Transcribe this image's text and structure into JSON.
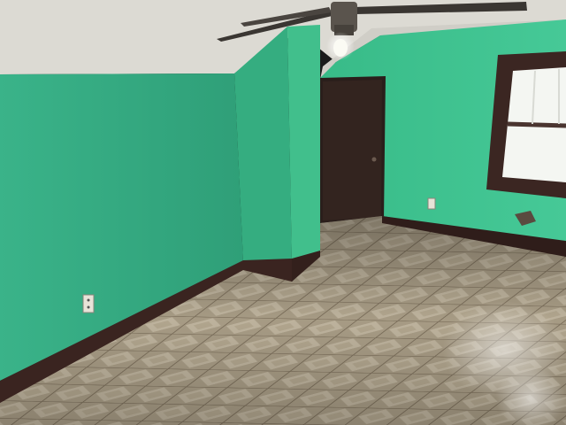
{
  "scene": {
    "subject": "",
    "elements": {
      "ceiling": "textured-ceiling",
      "fan": "ceiling-fan",
      "light": "bare-bulb",
      "left_wall": "green-wall",
      "column": "drywall-chase",
      "door": "dark-wood-door",
      "window": "double-hung-window",
      "floor": "vinyl-tile-floor",
      "outlet": "wall-outlet"
    }
  },
  "colors": {
    "wall_left": "#3fb58f",
    "wall_left_dark": "#2f9a76",
    "wall_right": "#3ec592",
    "wall_right_light": "#5ad4a3",
    "column_front": "#3fbd8a",
    "column_side": "#37a97e",
    "ceiling": "#e3e1da",
    "ceiling_shadow": "#c9c7c0",
    "baseboard": "#3a2420",
    "door": "#2a1e1b",
    "window_frame": "#3b2622",
    "window_glass": "#f4f6f2",
    "floor_base": "#b9ac93",
    "floor_grout": "#8a7c66",
    "floor_diamond": "#d2c6ae",
    "fan_metal": "#3a3632",
    "bulb": "#fbfbf4"
  }
}
